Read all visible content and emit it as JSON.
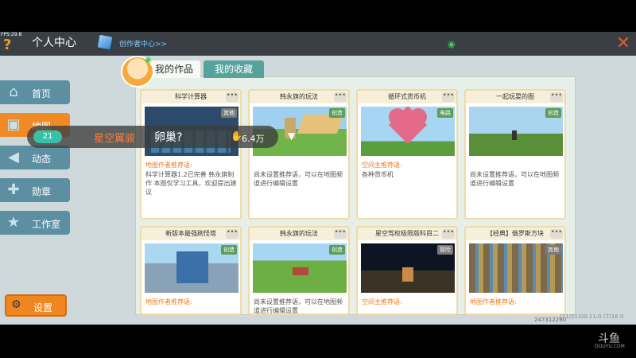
{
  "status": {
    "fps": "FPS:29.8"
  },
  "header": {
    "help_glyph": "?",
    "title": "个人中心",
    "creator_link": "创作者中心>>",
    "close_glyph": "✕"
  },
  "sidebar": {
    "items": [
      {
        "label": "首页"
      },
      {
        "label": "地图"
      },
      {
        "label": "动态"
      },
      {
        "label": "勋章"
      },
      {
        "label": "工作室"
      }
    ],
    "settings_label": "设置"
  },
  "tabs": {
    "works": "我的作品",
    "favorites": "我的收藏"
  },
  "cards": [
    {
      "title": "科学计算器",
      "badge": "其他",
      "rec_title": "地图作者推荐语:",
      "rec_body": "科学计算器1.2已完善\n韩永旗制作 本图仅学习工具，欢迎提出建议"
    },
    {
      "title": "韩永旗的玩法",
      "badge": "创造",
      "rec_title": "",
      "rec_body": "尚未设置推荐语，可以在地图频道进行编辑设置"
    },
    {
      "title": "循环式货币机",
      "badge": "电路",
      "rec_title": "空间主推荐语:",
      "rec_body": "各种货币机"
    },
    {
      "title": "一起玩耍的图",
      "badge": "创造",
      "rec_title": "",
      "rec_body": "尚未设置推荐语，可以在地图频道进行编辑设置"
    },
    {
      "title": "新版本最强刷怪塔",
      "badge": "创造",
      "rec_title": "地图作者推荐语:",
      "rec_body": ""
    },
    {
      "title": "韩永旗的玩法",
      "badge": "创造",
      "rec_title": "",
      "rec_body": "尚未设置推荐语，可以在地图频道进行编辑设置"
    },
    {
      "title": "星空驾权极限版科目二",
      "badge": "冒险",
      "rec_title": "空间主推荐语:",
      "rec_body": ""
    },
    {
      "title": "【经典】俄罗斯方块",
      "badge": "其他",
      "rec_title": "地图作者推荐语:",
      "rec_body": ""
    }
  ],
  "danmu": {
    "level": "21",
    "user": "星空翼骏",
    "message": "卵巢?",
    "likes": "6.4万"
  },
  "footer": {
    "uid": "247312290",
    "watermark": "(11/21)00:11:0  (7)16 0",
    "douyu": "斗鱼",
    "douyu_sub": "DOUYU.COM"
  },
  "icons": {
    "help": "question-icon",
    "close": "close-icon",
    "wifi": "wifi-icon",
    "creator": "cube-icon",
    "settings": "gear-icon"
  },
  "colors": {
    "accent": "#f08a24",
    "sidebar": "#5d8fa3",
    "tab_active": "#58a29c",
    "rec": "#f07a1c"
  }
}
